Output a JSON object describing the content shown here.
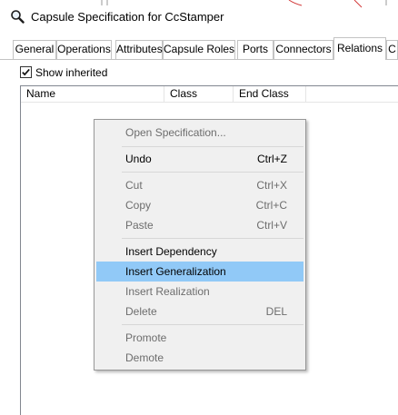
{
  "window": {
    "title": "Capsule Specification for CcStamper"
  },
  "tabs": [
    {
      "label": "General"
    },
    {
      "label": "Operations"
    },
    {
      "label": "Attributes"
    },
    {
      "label": "Capsule Roles"
    },
    {
      "label": "Ports"
    },
    {
      "label": "Connectors"
    },
    {
      "label": "Relations"
    },
    {
      "label": "C"
    }
  ],
  "active_tab": "Relations",
  "options": {
    "show_inherited_label": "Show inherited",
    "show_inherited_checked": true
  },
  "list": {
    "columns": [
      {
        "label": "Name"
      },
      {
        "label": "Class"
      },
      {
        "label": "End Class"
      }
    ],
    "rows": []
  },
  "context_menu": {
    "items": [
      {
        "label": "Open Specification...",
        "shortcut": "",
        "enabled": false
      },
      {
        "label": "Undo",
        "shortcut": "Ctrl+Z",
        "enabled": true
      },
      {
        "label": "Cut",
        "shortcut": "Ctrl+X",
        "enabled": false
      },
      {
        "label": "Copy",
        "shortcut": "Ctrl+C",
        "enabled": false
      },
      {
        "label": "Paste",
        "shortcut": "Ctrl+V",
        "enabled": false
      },
      {
        "label": "Insert Dependency",
        "shortcut": "",
        "enabled": true
      },
      {
        "label": "Insert Generalization",
        "shortcut": "",
        "enabled": true,
        "highlighted": true
      },
      {
        "label": "Insert Realization",
        "shortcut": "",
        "enabled": false
      },
      {
        "label": "Delete",
        "shortcut": "DEL",
        "enabled": false
      },
      {
        "label": "Promote",
        "shortcut": "",
        "enabled": false
      },
      {
        "label": "Demote",
        "shortcut": "",
        "enabled": false
      }
    ]
  },
  "colors": {
    "highlight": "#91c9f7",
    "menu_background": "#f0f0f0",
    "disabled_text": "#6d6d6d"
  },
  "icons": {
    "title": "magnifier-icon",
    "checkbox": "checkmark-icon"
  }
}
